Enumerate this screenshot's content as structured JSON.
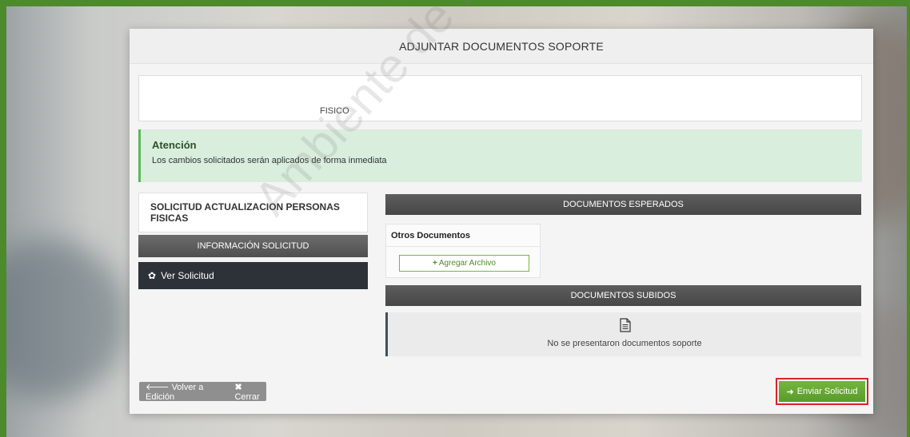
{
  "modal": {
    "title": "ADJUNTAR DOCUMENTOS SOPORTE",
    "person_type": "FISICO"
  },
  "alert": {
    "title": "Atención",
    "text": "Los cambios solicitados serán aplicados de forma inmediata"
  },
  "left": {
    "card_title": "SOLICITUD ACTUALIZACION PERSONAS FISICAS",
    "info_header": "INFORMACIÓN SOLICITUD",
    "ver_button": "Ver Solicitud",
    "ver_icon": "gear-icon"
  },
  "documentos_esperados": {
    "header": "DOCUMENTOS ESPERADOS",
    "card_title": "Otros Documentos",
    "add_button": "Agregar Archivo",
    "add_icon": "plus-icon"
  },
  "documentos_subidos": {
    "header": "DOCUMENTOS SUBIDOS",
    "empty_icon": "document-icon",
    "empty_text": "No se presentaron documentos soporte"
  },
  "footer": {
    "volver_label": "Volver a Edición",
    "volver_icon": "arrow-left-icon",
    "cerrar_label": "Cerrar",
    "cerrar_icon": "close-icon",
    "enviar_label": "Enviar Solicitud",
    "enviar_icon": "arrow-right-icon"
  },
  "watermark": "Ambiente de Pruebas",
  "colors": {
    "frame": "#4d8a2c",
    "alert_bg": "#d9eedd",
    "enviar_bg": "#6aad34",
    "highlight": "#d6242a"
  }
}
